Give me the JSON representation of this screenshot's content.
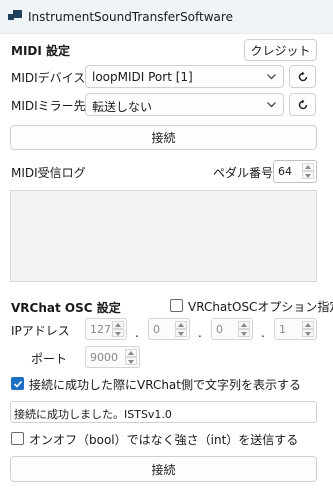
{
  "window": {
    "title": "InstrumentSoundTransferSoftware"
  },
  "midi": {
    "heading": "MIDI 設定",
    "credit_label": "クレジット",
    "device_label": "MIDIデバイス",
    "device_value": "loopMIDI Port [1]",
    "mirror_label": "MIDIミラー先",
    "mirror_value": "転送しない",
    "connect_label": "接続",
    "log_label": "MIDI受信ログ",
    "pedal_label": "ペダル番号",
    "pedal_value": "64",
    "log_content": ""
  },
  "osc": {
    "heading": "VRChat OSC 設定",
    "option_label": "VRChatOSCオプション指定",
    "option_checked": false,
    "ip_label": "IPアドレス",
    "ip": [
      "127",
      "0",
      "0",
      "1"
    ],
    "port_label": "ポート",
    "port_value": "9000",
    "show_text_label": "接続に成功した際にVRChat側で文字列を表示する",
    "show_text_checked": true,
    "message_value": "接続に成功しました。ISTSv1.0",
    "strength_label": "オンオフ（bool）ではなく強さ（int）を送信する",
    "strength_checked": false,
    "connect_label": "接続"
  },
  "icons": {
    "app": "app-window-icon",
    "chevron": "chevron-down-icon",
    "refresh": "refresh-icon",
    "check": "checkmark-icon"
  },
  "colors": {
    "accent": "#1e6fc4",
    "titlebar": "#eff4f9"
  }
}
